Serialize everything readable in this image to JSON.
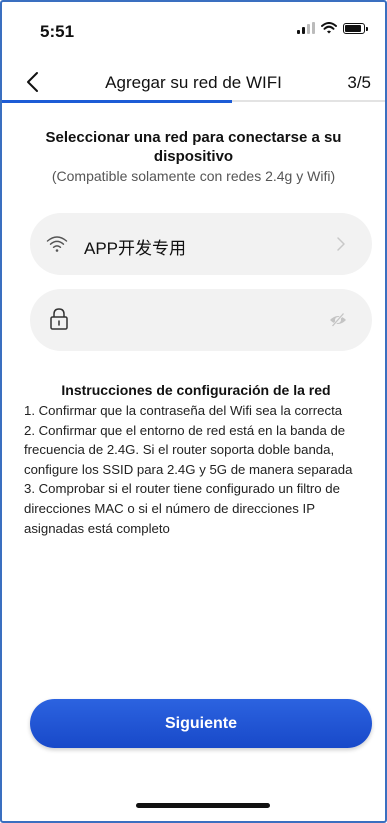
{
  "status_bar": {
    "time": "5:51"
  },
  "nav": {
    "title": "Agregar su red de WIFI",
    "step": "3/5",
    "progress": 0.6
  },
  "content": {
    "heading": "Seleccionar una red para conectarse a su dispositivo",
    "subheading": "(Compatible solamente con redes 2.4g y Wifi)",
    "wifi_field": {
      "network_name": "APP开发专用"
    },
    "password_field": {
      "value": "",
      "placeholder": ""
    },
    "instructions": {
      "title": "Instrucciones de configuración de la red",
      "items": [
        "1. Confirmar que la contraseña del Wifi sea la correcta",
        "2. Confirmar que el entorno de red está en la banda de frecuencia de 2.4G. Si el router soporta doble banda, configure los SSID para 2.4G y 5G de manera separada",
        "3. Comprobar si el router tiene configurado un filtro de direcciones MAC o si el número de direcciones IP asignadas está completo"
      ]
    },
    "next_button": "Siguiente"
  },
  "colors": {
    "accent": "#1d5cd6",
    "field_bg": "#f2f2f2",
    "text": "#111111",
    "muted": "#555555"
  },
  "icons": [
    "back-icon",
    "wifi-icon",
    "chevron-right-icon",
    "lock-icon",
    "eye-hidden-icon",
    "signal-icon",
    "wifi-status-icon",
    "battery-icon"
  ]
}
